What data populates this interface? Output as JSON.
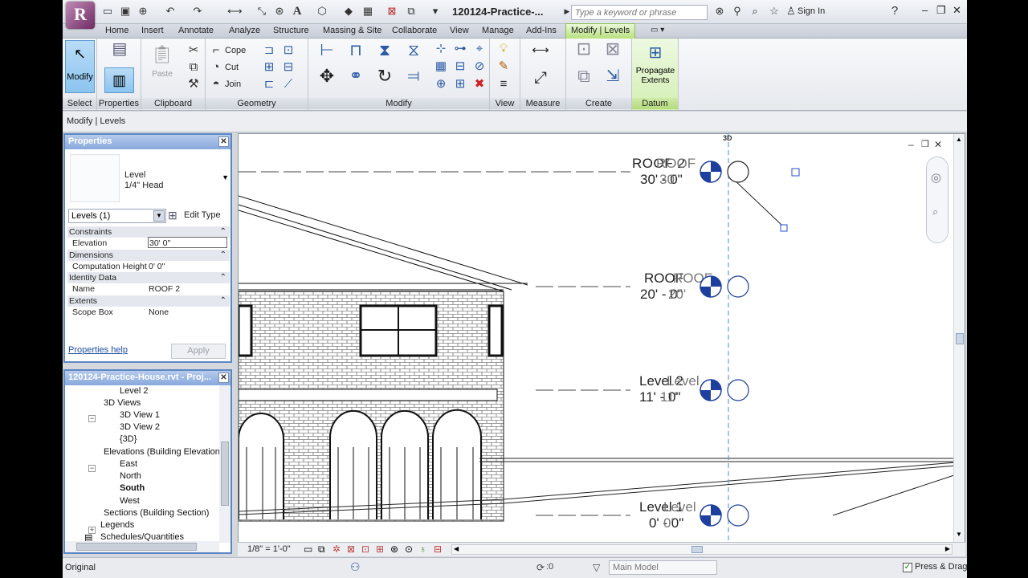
{
  "window": {
    "app_logo": "R",
    "title": "120124-Practice-...",
    "search_placeholder": "Type a keyword or phrase",
    "signin": "Sign In"
  },
  "tabs": [
    {
      "label": "Home"
    },
    {
      "label": "Insert"
    },
    {
      "label": "Annotate"
    },
    {
      "label": "Analyze"
    },
    {
      "label": "Structure"
    },
    {
      "label": "Massing & Site"
    },
    {
      "label": "Collaborate"
    },
    {
      "label": "View"
    },
    {
      "label": "Manage"
    },
    {
      "label": "Add-Ins"
    },
    {
      "label": "Modify | Levels"
    }
  ],
  "ribbon": {
    "panels": {
      "select": "Select",
      "properties": "Properties",
      "clipboard": "Clipboard",
      "geometry": "Geometry",
      "modify": "Modify",
      "view": "View",
      "measure": "Measure",
      "create": "Create",
      "datum": "Datum"
    },
    "modify_btn": "Modify",
    "paste_btn": "Paste",
    "cope": "Cope",
    "cut": "Cut",
    "join": "Join",
    "propagate_line1": "Propagate",
    "propagate_line2": "Extents"
  },
  "options_bar": {
    "context": "Modify | Levels"
  },
  "properties": {
    "title": "Properties",
    "type_family": "Level",
    "type_name": "1/4\" Head",
    "instance_filter": "Levels (1)",
    "edit_type": "Edit Type",
    "rows": [
      {
        "kind": "cat",
        "label": "Constraints"
      },
      {
        "kind": "row",
        "label": "Elevation",
        "value": "30'  0\"",
        "selected": true
      },
      {
        "kind": "cat",
        "label": "Dimensions"
      },
      {
        "kind": "row",
        "label": "Computation Height",
        "value": "0'  0\""
      },
      {
        "kind": "cat",
        "label": "Identity Data"
      },
      {
        "kind": "row",
        "label": "Name",
        "value": "ROOF 2"
      },
      {
        "kind": "cat",
        "label": "Extents"
      },
      {
        "kind": "row",
        "label": "Scope Box",
        "value": "None"
      }
    ],
    "help_link": "Properties help",
    "apply": "Apply"
  },
  "browser": {
    "title": "120124-Practice-House.rvt - Proj...",
    "items": [
      {
        "label": "Level 2",
        "indent": 2
      },
      {
        "label": "3D Views",
        "indent": 1,
        "expander": "−"
      },
      {
        "label": "3D View 1",
        "indent": 2
      },
      {
        "label": "3D View 2",
        "indent": 2
      },
      {
        "label": "{3D}",
        "indent": 2
      },
      {
        "label": "Elevations (Building Elevation)",
        "indent": 1,
        "expander": "−"
      },
      {
        "label": "East",
        "indent": 2
      },
      {
        "label": "North",
        "indent": 2
      },
      {
        "label": "South",
        "indent": 2,
        "bold": true
      },
      {
        "label": "West",
        "indent": 2
      },
      {
        "label": "Sections (Building Section)",
        "indent": 1,
        "expander": "+"
      },
      {
        "label": "Legends",
        "indent": 0
      },
      {
        "label": "Schedules/Quantities",
        "indent": 0
      }
    ]
  },
  "canvas": {
    "viewcube_label": "3D",
    "levels": [
      {
        "name": "ROOF 2",
        "ghost": "ROOF",
        "elev": "30' - 0\"",
        "ghost_elev": "30'",
        "y": 0
      },
      {
        "name": "ROOF",
        "ghost": "ROOF",
        "elev": "20' - 0\"",
        "ghost_elev": "20'",
        "y": 1
      },
      {
        "name": "Level 2",
        "ghost": "Level",
        "elev": "11' - 0\"",
        "ghost_elev": "11'",
        "y": 2
      },
      {
        "name": "Level 1",
        "ghost": "Level",
        "elev": "0' - 0\"",
        "ghost_elev": "0'",
        "y": 3
      }
    ]
  },
  "view_controls": {
    "scale": "1/8\" = 1'-0\""
  },
  "status_bar": {
    "text": "Original",
    "count": ":0",
    "model": "Main Model",
    "press_drag": "Press & Drag"
  }
}
